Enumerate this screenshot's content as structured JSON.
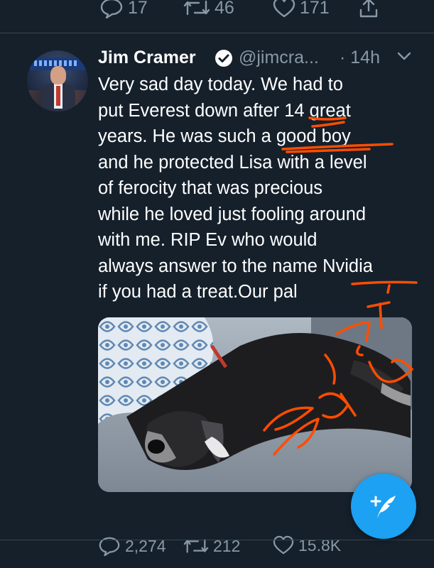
{
  "previous_tweet": {
    "reply_count": "17",
    "retweet_count": "46",
    "like_count": "171"
  },
  "tweet": {
    "author_name": "Jim Cramer",
    "handle": "@jimcra...",
    "time": "· 14h",
    "text": "Very sad day today. We had to\nput Everest down after 14 great\nyears. He was such a good boy\nand he protected Lisa with a level\nof ferocity that was precious\nwhile he loved just fooling around\nwith me. RIP Ev who would\nalways answer to the name Nvidia\nif you had a treat.Our pal",
    "reply_count": "2,274",
    "retweet_count": "212",
    "like_count": "15.8K"
  },
  "icons": {
    "reply": "reply-icon",
    "retweet": "retweet-icon",
    "like": "heart-icon",
    "share": "share-icon",
    "verified": "verified-badge-icon",
    "more": "chevron-down-icon",
    "compose": "compose-tweet-icon"
  },
  "colors": {
    "background": "#15202b",
    "secondary_text": "#8899a6",
    "accent": "#1da1f2",
    "annotation": "#ff4d00",
    "divider": "#38444d"
  }
}
